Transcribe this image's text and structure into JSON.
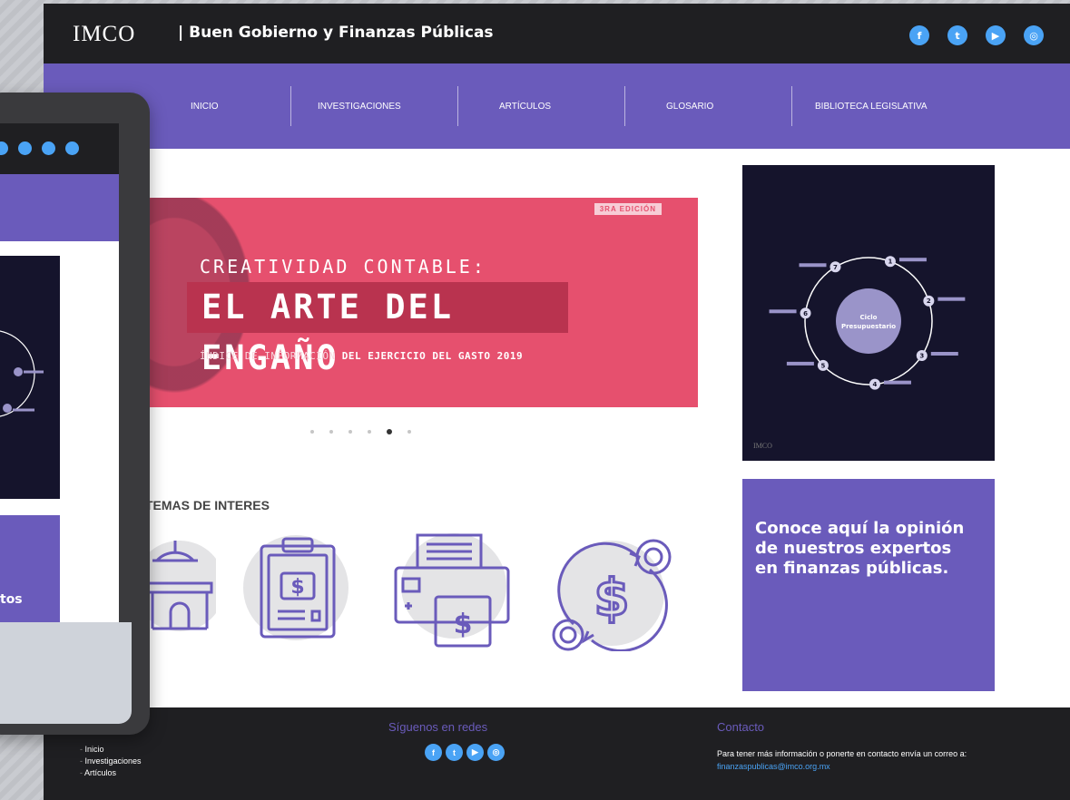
{
  "site": {
    "logo": "IMCO",
    "title": "| Buen Gobierno y Finanzas Públicas",
    "social_icons": [
      "facebook-icon",
      "twitter-icon",
      "youtube-icon",
      "instagram-icon"
    ]
  },
  "nav": {
    "items": [
      "INICIO",
      "INVESTIGACIONES",
      "ARTÍCULOS",
      "GLOSARIO",
      "BIBLIOTECA LEGISLATIVA"
    ]
  },
  "banner": {
    "badge": "3RA EDICIÓN",
    "line1": "CREATIVIDAD CONTABLE:",
    "line2": "EL ARTE DEL ENGAÑO",
    "line3_prefix": "ÍNDICE DE INFORMACIÓN",
    "line3_bold": "DEL EJERCICIO DEL GASTO 2019"
  },
  "carousel": {
    "count": 6,
    "active_index": 4
  },
  "topics": {
    "title": "TEMAS DE INTERES",
    "icons": [
      "government-building-icon",
      "budget-clipboard-icon",
      "printer-money-icon",
      "money-exchange-icon"
    ]
  },
  "side_image": {
    "center_label_1": "Ciclo",
    "center_label_2": "Presupuestario",
    "steps": [
      "1",
      "2",
      "3",
      "4",
      "5",
      "6",
      "7"
    ],
    "footer": "IMCO"
  },
  "side_card": {
    "text": "Conoce aquí la opinión de nuestros expertos en finanzas públicas."
  },
  "footer": {
    "heading_social": "Síguenos en redes",
    "heading_contact": "Contacto",
    "links": [
      "Inicio",
      "Investigaciones",
      "Artículos"
    ],
    "contact_text": "Para tener más información o ponerte en contacto envía un correo a:",
    "contact_email": "finanzaspublicas@imco.org.mx"
  },
  "tablet_preview": {
    "card_text_fragment": "tos"
  },
  "colors": {
    "topbar": "#1f1f22",
    "nav": "#6a5bbb",
    "banner": "#e6506e",
    "social": "#4aa3f5",
    "icon_stroke": "#6a5bbb",
    "icon_fill": "#e4e4e6",
    "side_image_bg": "#15142c"
  }
}
